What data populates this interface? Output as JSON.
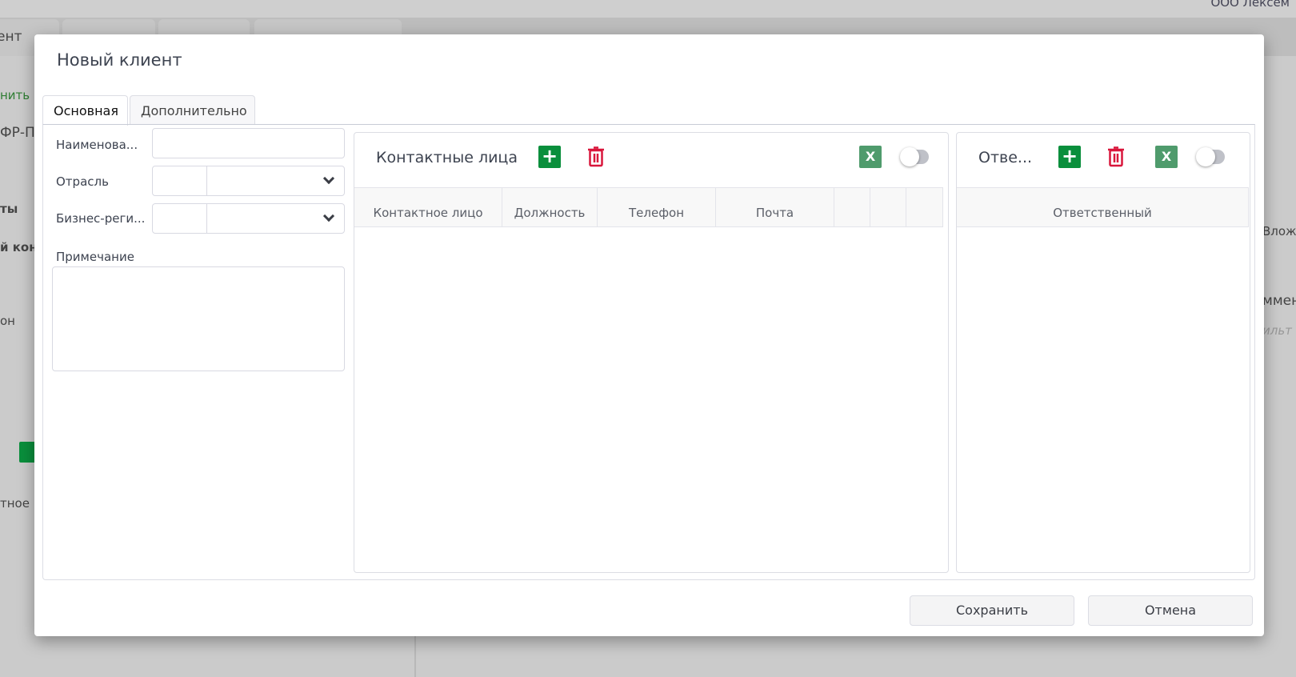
{
  "background": {
    "user_name": "ООО Лексем",
    "tab_fragment": "ент",
    "side_fragments": [
      "нить",
      "ФР-ПЛ",
      "ты",
      "й конт",
      "он",
      "тное ."
    ],
    "right_fragments": [
      "Вложе",
      "ммен",
      "ильт"
    ]
  },
  "modal": {
    "title": "Новый клиент",
    "tabs": [
      {
        "label": "Основная"
      },
      {
        "label": "Дополнительно"
      }
    ],
    "form": {
      "name_label": "Наименова...",
      "name_value": "",
      "industry_label": "Отрасль",
      "region_label": "Бизнес-реги...",
      "note_label": "Примечание",
      "note_value": ""
    },
    "contacts": {
      "title": "Контактные лица",
      "excel_label": "X",
      "columns": [
        "Контактное лицо",
        "Должность",
        "Телефон",
        "Почта",
        "",
        "",
        ""
      ]
    },
    "responsible": {
      "title": "Отве...",
      "excel_label": "X",
      "columns": [
        "Ответственный"
      ]
    },
    "save_label": "Сохранить",
    "cancel_label": "Отмена"
  },
  "colors": {
    "add": "#0a8f3c",
    "delete": "#d9163b",
    "excel": "#4f9b6c"
  }
}
